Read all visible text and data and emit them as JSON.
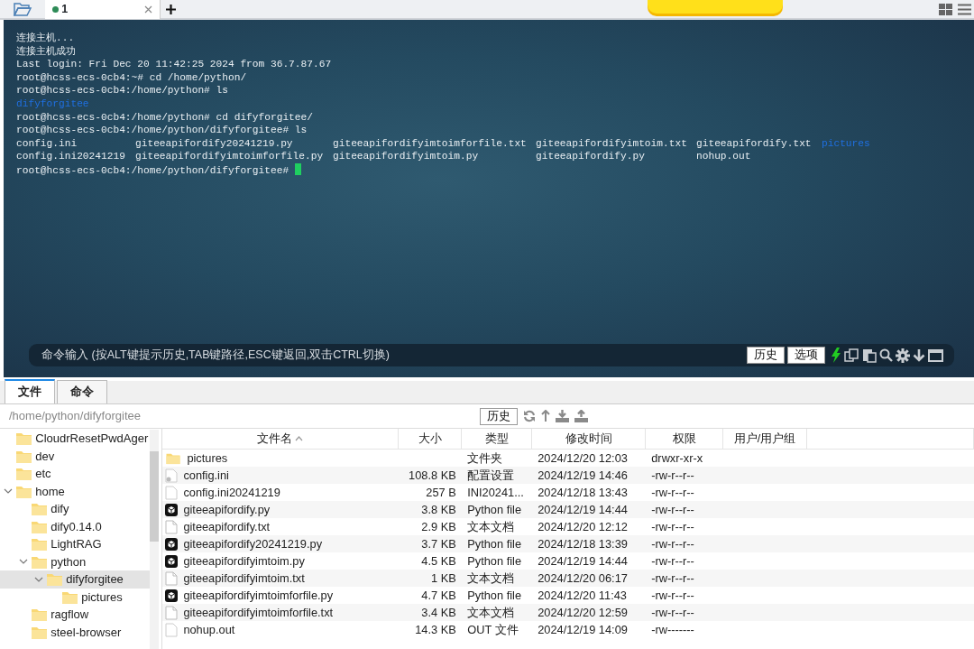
{
  "tab_bar": {
    "session_tab": {
      "title": "1"
    }
  },
  "terminal": {
    "lines": [
      {
        "kind": "text",
        "text": "连接主机..."
      },
      {
        "kind": "text",
        "text": "连接主机成功"
      },
      {
        "kind": "text",
        "text": "Last login: Fri Dec 20 11:42:25 2024 from 36.7.87.67"
      },
      {
        "kind": "text",
        "text": "root@hcss-ecs-0cb4:~# cd /home/python/"
      },
      {
        "kind": "text",
        "text": "root@hcss-ecs-0cb4:/home/python# ls"
      },
      {
        "kind": "dir",
        "text": "difyforgitee"
      },
      {
        "kind": "text",
        "text": "root@hcss-ecs-0cb4:/home/python# cd difyforgitee/"
      },
      {
        "kind": "text",
        "text": "root@hcss-ecs-0cb4:/home/python/difyforgitee# ls"
      },
      {
        "kind": "ls",
        "entries": [
          {
            "name": "config.ini",
            "kind": "file"
          },
          {
            "name": "giteeapifordify20241219.py",
            "kind": "file"
          },
          {
            "name": "giteeapifordifyimtoimforfile.txt",
            "kind": "file"
          },
          {
            "name": "giteeapifordifyimtoim.txt",
            "kind": "file"
          },
          {
            "name": "giteeapifordify.txt",
            "kind": "file"
          },
          {
            "name": "pictures",
            "kind": "dir"
          }
        ]
      },
      {
        "kind": "ls",
        "entries": [
          {
            "name": "config.ini20241219",
            "kind": "file"
          },
          {
            "name": "giteeapifordifyimtoimforfile.py",
            "kind": "file"
          },
          {
            "name": "giteeapifordifyimtoim.py",
            "kind": "file"
          },
          {
            "name": "giteeapifordify.py",
            "kind": "file"
          },
          {
            "name": "nohup.out",
            "kind": "file"
          }
        ]
      },
      {
        "kind": "prompt",
        "text": "root@hcss-ecs-0cb4:/home/python/difyforgitee# ",
        "cursor": true
      }
    ]
  },
  "command_bar": {
    "placeholder": "命令输入 (按ALT键提示历史,TAB键路径,ESC键返回,双击CTRL切换)",
    "buttons": [
      "历史",
      "选项"
    ]
  },
  "panel_tabs": [
    {
      "label": "文件",
      "selected": true
    },
    {
      "label": "命令",
      "selected": false
    }
  ],
  "path_bar": {
    "value": "/home/python/difyforgitee",
    "history_button": "历史"
  },
  "tree": {
    "items": [
      {
        "label": "CloudrResetPwdAger"
      },
      {
        "label": "dev"
      },
      {
        "label": "etc"
      },
      {
        "label": "home",
        "expanded": true,
        "children": [
          {
            "label": "dify"
          },
          {
            "label": "dify0.14.0"
          },
          {
            "label": "LightRAG"
          },
          {
            "label": "python",
            "expanded": true,
            "children": [
              {
                "label": "difyforgitee",
                "expanded": true,
                "selected": true,
                "children": [
                  {
                    "label": "pictures"
                  }
                ]
              }
            ]
          },
          {
            "label": "ragflow"
          },
          {
            "label": "steel-browser"
          }
        ]
      }
    ]
  },
  "file_table": {
    "columns": [
      {
        "label": "文件名",
        "sorted": true
      },
      {
        "label": "大小",
        "sorted": false
      },
      {
        "label": "类型",
        "sorted": false
      },
      {
        "label": "修改时间",
        "sorted": false
      },
      {
        "label": "权限",
        "sorted": false
      },
      {
        "label": "用户/用户组",
        "sorted": false
      }
    ],
    "rows": [
      {
        "kind": "folder",
        "name": "pictures",
        "type": "文件夹",
        "modified": "2024/12/20 12:03",
        "permissions": "drwxr-xr-x"
      },
      {
        "kind": "config",
        "name": "config.ini",
        "size": "108.8 KB",
        "type": "配置设置",
        "modified": "2024/12/19 14:46",
        "permissions": "-rw-r--r--"
      },
      {
        "kind": "blank",
        "name": "config.ini20241219",
        "size": "257 B",
        "type": "INI20241...",
        "modified": "2024/12/18 13:43",
        "permissions": "-rw-r--r--"
      },
      {
        "kind": "python",
        "name": "giteeapifordify.py",
        "size": "3.8 KB",
        "type": "Python file",
        "modified": "2024/12/19 14:44",
        "permissions": "-rw-r--r--"
      },
      {
        "kind": "text",
        "name": "giteeapifordify.txt",
        "size": "2.9 KB",
        "type": "文本文档",
        "modified": "2024/12/20 12:12",
        "permissions": "-rw-r--r--"
      },
      {
        "kind": "python",
        "name": "giteeapifordify20241219.py",
        "size": "3.7 KB",
        "type": "Python file",
        "modified": "2024/12/18 13:39",
        "permissions": "-rw-r--r--"
      },
      {
        "kind": "python",
        "name": "giteeapifordifyimtoim.py",
        "size": "4.5 KB",
        "type": "Python file",
        "modified": "2024/12/19 14:44",
        "permissions": "-rw-r--r--"
      },
      {
        "kind": "text",
        "name": "giteeapifordifyimtoim.txt",
        "size": "1 KB",
        "type": "文本文档",
        "modified": "2024/12/20 06:17",
        "permissions": "-rw-r--r--"
      },
      {
        "kind": "python",
        "name": "giteeapifordifyimtoimforfile.py",
        "size": "4.7 KB",
        "type": "Python file",
        "modified": "2024/12/20 11:43",
        "permissions": "-rw-r--r--"
      },
      {
        "kind": "text",
        "name": "giteeapifordifyimtoimforfile.txt",
        "size": "3.4 KB",
        "type": "文本文档",
        "modified": "2024/12/20 12:59",
        "permissions": "-rw-r--r--"
      },
      {
        "kind": "blank",
        "name": "nohup.out",
        "size": "14.3 KB",
        "type": "OUT 文件",
        "modified": "2024/12/19 14:09",
        "permissions": "-rw-------"
      }
    ]
  }
}
